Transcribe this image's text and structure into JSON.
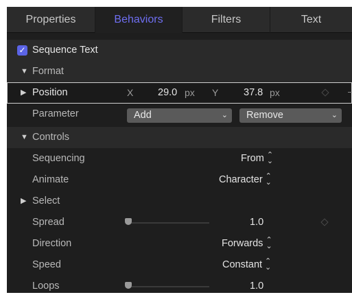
{
  "tabs": [
    "Properties",
    "Behaviors",
    "Filters",
    "Text"
  ],
  "active_tab": "Behaviors",
  "accent_color": "#6f6ff2",
  "behavior": {
    "name": "Sequence Text",
    "enabled": true
  },
  "format": {
    "label": "Format",
    "position": {
      "label": "Position",
      "x_label": "X",
      "x_value": "29.0",
      "x_unit": "px",
      "y_label": "Y",
      "y_value": "37.8",
      "y_unit": "px"
    },
    "parameter": {
      "label": "Parameter",
      "add": "Add",
      "remove": "Remove"
    }
  },
  "controls": {
    "label": "Controls",
    "sequencing": {
      "label": "Sequencing",
      "value": "From"
    },
    "animate": {
      "label": "Animate",
      "value": "Character"
    },
    "select": {
      "label": "Select"
    },
    "spread": {
      "label": "Spread",
      "value": "1.0"
    },
    "direction": {
      "label": "Direction",
      "value": "Forwards"
    },
    "speed": {
      "label": "Speed",
      "value": "Constant"
    },
    "loops": {
      "label": "Loops",
      "value": "1.0"
    }
  }
}
